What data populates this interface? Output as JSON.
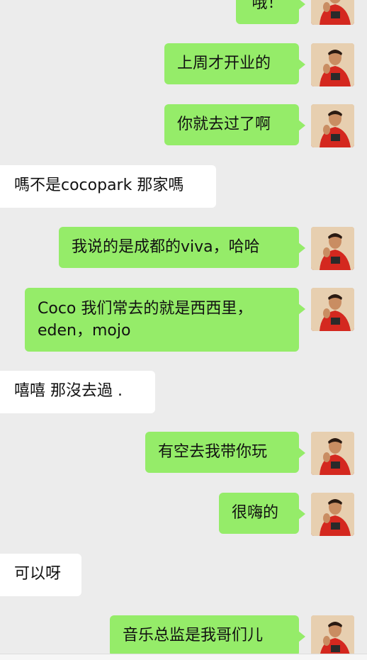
{
  "chat": {
    "messages": [
      {
        "side": "out",
        "text": "哦！"
      },
      {
        "side": "out",
        "text": "上周才开业的"
      },
      {
        "side": "out",
        "text": "你就去过了啊"
      },
      {
        "side": "in",
        "text": "嗎不是cocopark 那家嗎"
      },
      {
        "side": "out",
        "text": "我说的是成都的viva，哈哈"
      },
      {
        "side": "out",
        "lines": [
          "Coco 我们常去的就是西西里，",
          "eden，mojo"
        ]
      },
      {
        "side": "in",
        "text": "嘻嘻 那沒去過 ."
      },
      {
        "side": "out",
        "text": "有空去我带你玩"
      },
      {
        "side": "out",
        "text": "很嗨的"
      },
      {
        "side": "in",
        "text": "可以呀"
      },
      {
        "side": "out",
        "text": "音乐总监是我哥们儿"
      }
    ]
  },
  "icons": {
    "avatar": "user-avatar-red-shirt"
  },
  "colors": {
    "background": "#ececec",
    "outgoing_bubble": "#95ec69",
    "incoming_bubble": "#ffffff"
  }
}
